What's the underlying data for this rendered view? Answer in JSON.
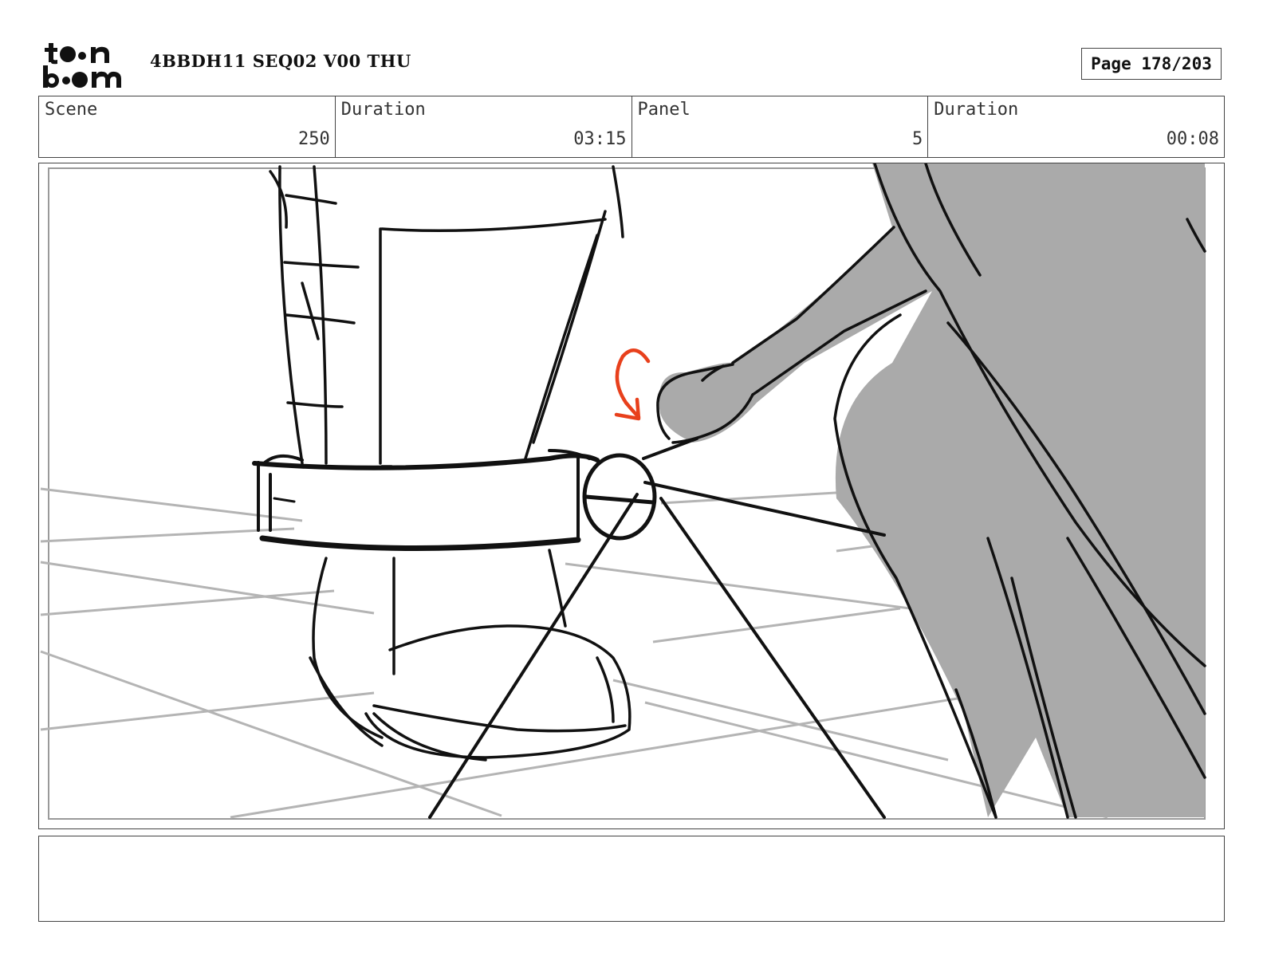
{
  "header": {
    "logo_text": "toon boom",
    "project_title": "4BBDH11 SEQ02 V00 THU",
    "page_label": "Page 178/203"
  },
  "info": {
    "scene_label": "Scene",
    "scene_value": "250",
    "scene_duration_label": "Duration",
    "scene_duration_value": "03:15",
    "panel_label": "Panel",
    "panel_value": "5",
    "panel_duration_label": "Duration",
    "panel_duration_value": "00:08"
  },
  "colors": {
    "ink": "#111111",
    "shadow_fill": "#aaaaaa",
    "floor_lines": "#b4b4b4",
    "arrow_accent": "#e8401c"
  },
  "notes": {
    "text": ""
  }
}
